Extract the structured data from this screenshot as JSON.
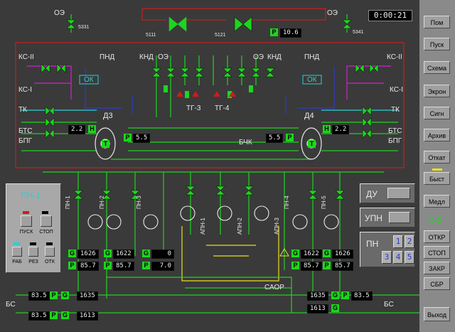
{
  "timer": "0:00:21",
  "p_main": "10.6",
  "tags": {
    "h": "H",
    "p": "P",
    "t": "T",
    "g": "G"
  },
  "top": {
    "oe_left": "ОЭ",
    "oe_right": "ОЭ",
    "v5331": "5331",
    "v5341": "5341",
    "v5111": "5111",
    "v5121": "5121"
  },
  "labels": {
    "ks2": "КС-II",
    "ks1": "КС-I",
    "tk": "ТК",
    "bts": "БТС",
    "bpg": "БПГ",
    "pnd": "ПНД",
    "knd": "КНД",
    "oe": "ОЭ",
    "ok": "ОК",
    "tg3": "ТГ-3",
    "tg4": "ТГ-4",
    "d3": "Д3",
    "d4": "Д4",
    "bchk": "БЧК",
    "saor": "САОР",
    "bs": "БС",
    "pn1": "ПН-1",
    "pn2": "ПН-2",
    "pn3": "ПН-3",
    "pn4": "ПН-4",
    "pn5": "ПН-5",
    "apn1": "АПН-1",
    "apn2": "АПН-2",
    "apn3": "АПН-3"
  },
  "valve_ids": [
    "6411",
    "6412",
    "6311",
    "6521",
    "6531",
    "5411",
    "5412",
    "623",
    "624",
    "6211",
    "6221",
    "6731",
    "6741",
    "6113",
    "6112",
    "6110",
    "6720",
    "6721",
    "5311",
    "5321",
    "3211",
    "3221",
    "5301",
    "5501",
    "5511",
    "5512",
    "5521",
    "5502",
    "7161",
    "7711",
    "7721",
    "7171",
    "7111",
    "7121",
    "7131",
    "7141",
    "7151",
    "7411",
    "7421",
    "7431",
    "7214",
    "7224",
    "7234",
    "7244",
    "7254",
    "7414",
    "7424",
    "7434",
    "7522",
    "7532",
    "7512",
    "7542",
    "7534",
    "7212",
    "7222",
    "7232",
    "7242",
    "7252",
    "7311",
    "7321",
    "7341",
    "7351"
  ],
  "displays": {
    "h_left": "2.2",
    "h_right": "2.2",
    "p_left": "5.5",
    "p_right": "5.5",
    "g_1626": "1626",
    "g_1622": "1622",
    "g_0": "0",
    "g_1622b": "1622",
    "g_1626b": "1626",
    "p_857a": "85.7",
    "p_857b": "85.7",
    "p_70": "7.0",
    "p_857c": "85.7",
    "p_857d": "85.7",
    "bs_835": "83.5",
    "bs_1635": "1635",
    "bs_1613": "1613",
    "br_1635": "1635",
    "br_835": "83.5",
    "br_1613": "1613",
    "bl_835b": "83.5"
  },
  "pn_panel": {
    "title": "ПН-1",
    "btn_start": "ПУСК",
    "btn_stop": "СТОП",
    "btn_rab": "РАБ",
    "btn_rez": "РЕЗ",
    "btn_otk": "ОТК"
  },
  "right_panel": {
    "du": "ДУ",
    "upn": "УПН",
    "pn": "ПН",
    "n1": "1",
    "n2": "2",
    "n3": "3",
    "n4": "4",
    "n5": "5"
  },
  "sidebar": [
    {
      "label": "Пом",
      "key": "pom"
    },
    {
      "label": "Пуск",
      "key": "pusk"
    },
    {
      "label": "Схема",
      "key": "schema"
    },
    {
      "label": "Экрон",
      "key": "ekron"
    },
    {
      "label": "Сигн",
      "key": "sign"
    },
    {
      "label": "Архив",
      "key": "arhiv"
    },
    {
      "label": "Откат",
      "key": "otkat"
    },
    {
      "label": "Быст",
      "key": "byst"
    },
    {
      "label": "Медл",
      "key": "medl"
    },
    {
      "label": "ОТКР",
      "key": "otkr"
    },
    {
      "label": "СТОП",
      "key": "stop"
    },
    {
      "label": "ЗАКР",
      "key": "zakr"
    },
    {
      "label": "СБР",
      "key": "sbr"
    },
    {
      "label": "Выход",
      "key": "vyhod"
    }
  ],
  "colors": {
    "bg": "#3a3a3a",
    "green": "#1fd41f",
    "red": "#c81e1e",
    "magenta": "#d020d0",
    "blue": "#2a3ad0",
    "cyan": "#2ad0d0",
    "yellow": "#e8e020",
    "white": "#e8e8e8"
  }
}
